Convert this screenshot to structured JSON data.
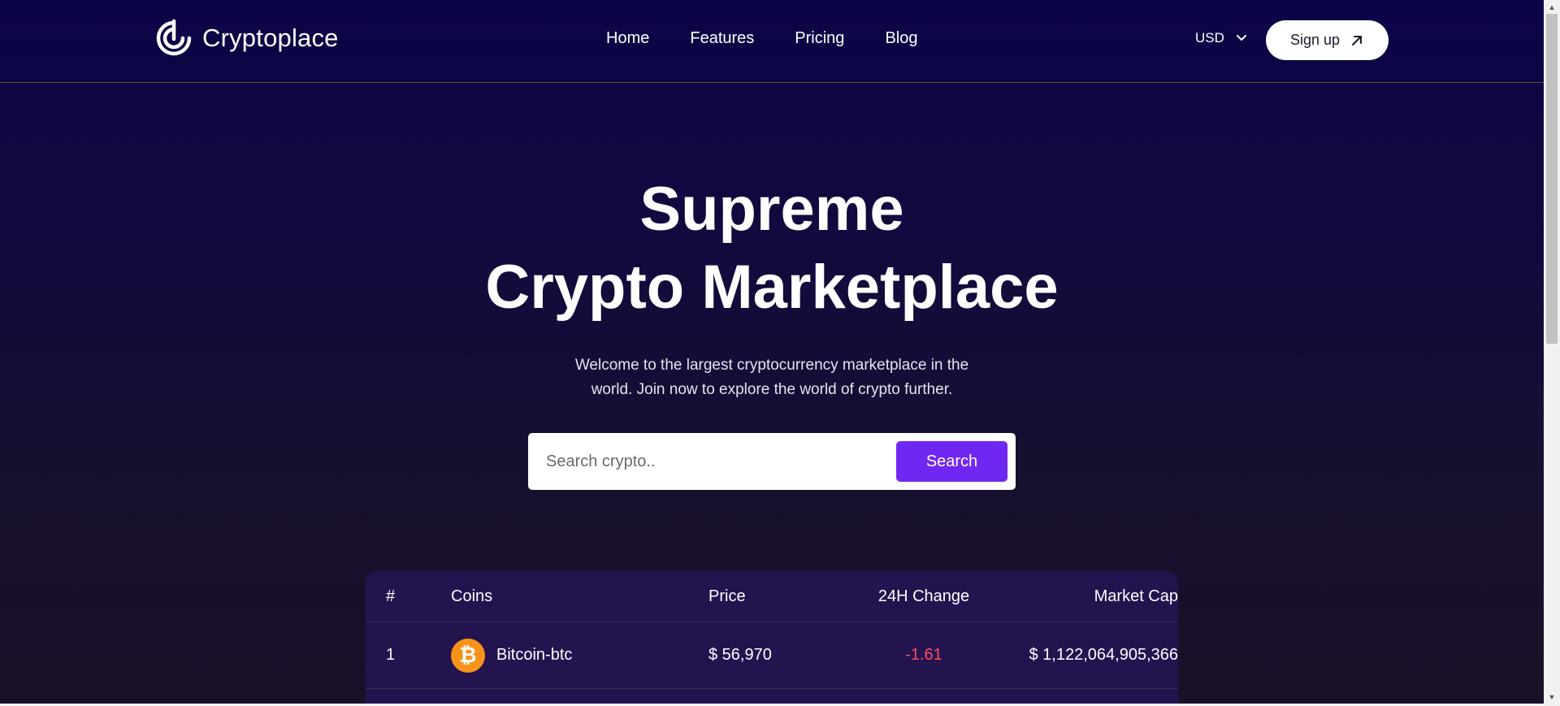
{
  "nav": {
    "logo_text": "Cryptoplace",
    "links": [
      "Home",
      "Features",
      "Pricing",
      "Blog"
    ],
    "currency": "USD",
    "signup_label": "Sign up"
  },
  "hero": {
    "title_line1": "Supreme",
    "title_line2": "Crypto Marketplace",
    "subtitle_line1": "Welcome to the largest cryptocurrency marketplace in the",
    "subtitle_line2": "world. Join now to explore the world of crypto further.",
    "search_placeholder": "Search crypto..",
    "search_button": "Search"
  },
  "table": {
    "headers": [
      "#",
      "Coins",
      "Price",
      "24H Change",
      "Market Cap"
    ],
    "rows": [
      {
        "rank": "1",
        "coin": "Bitcoin-btc",
        "price": "$ 56,970",
        "change": "-1.61",
        "market_cap": "$ 1,122,064,905,366"
      }
    ]
  },
  "colors": {
    "accent": "#7127f2",
    "negative": "#ff4d5a",
    "bitcoin": "#f7931a",
    "table_bg": "#231450"
  },
  "icons": {
    "logo": "target-logo-icon",
    "currency_dropdown": "chevron-down-icon",
    "signup_arrow": "arrow-up-right-icon",
    "coin": "bitcoin-icon"
  }
}
